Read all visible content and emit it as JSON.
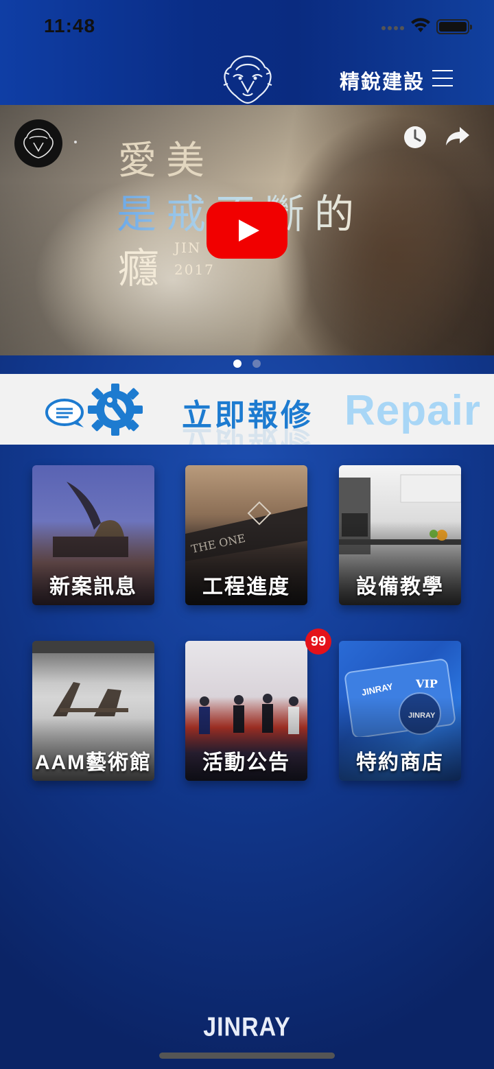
{
  "status_bar": {
    "time": "11:48"
  },
  "header": {
    "brand_title": "精銳建設",
    "menu_icon": "hamburger-menu-icon",
    "logo_icon": "lion-logo-icon"
  },
  "video": {
    "line1": "愛美",
    "line2": "是戒不斷的",
    "line3": "癮",
    "sub_top": "JIN",
    "year": "2017",
    "controls": [
      "clock-icon",
      "share-icon",
      "play-icon"
    ]
  },
  "carousel_dots": {
    "count": 2,
    "active": 0
  },
  "repair": {
    "label_zh": "立即報修",
    "label_en": "Repair"
  },
  "tiles": [
    {
      "label": "新案訊息"
    },
    {
      "label": "工程進度"
    },
    {
      "label": "設備教學"
    },
    {
      "label": "AAM藝術館"
    },
    {
      "label": "活動公告"
    },
    {
      "label": "特約商店"
    }
  ],
  "notification_badge": "99",
  "footer": {
    "brand": "JINRAY"
  },
  "colors": {
    "accent_blue": "#1d7bd0",
    "play_red": "#f10000",
    "badge_red": "#e4121a",
    "background": "#123a92"
  }
}
